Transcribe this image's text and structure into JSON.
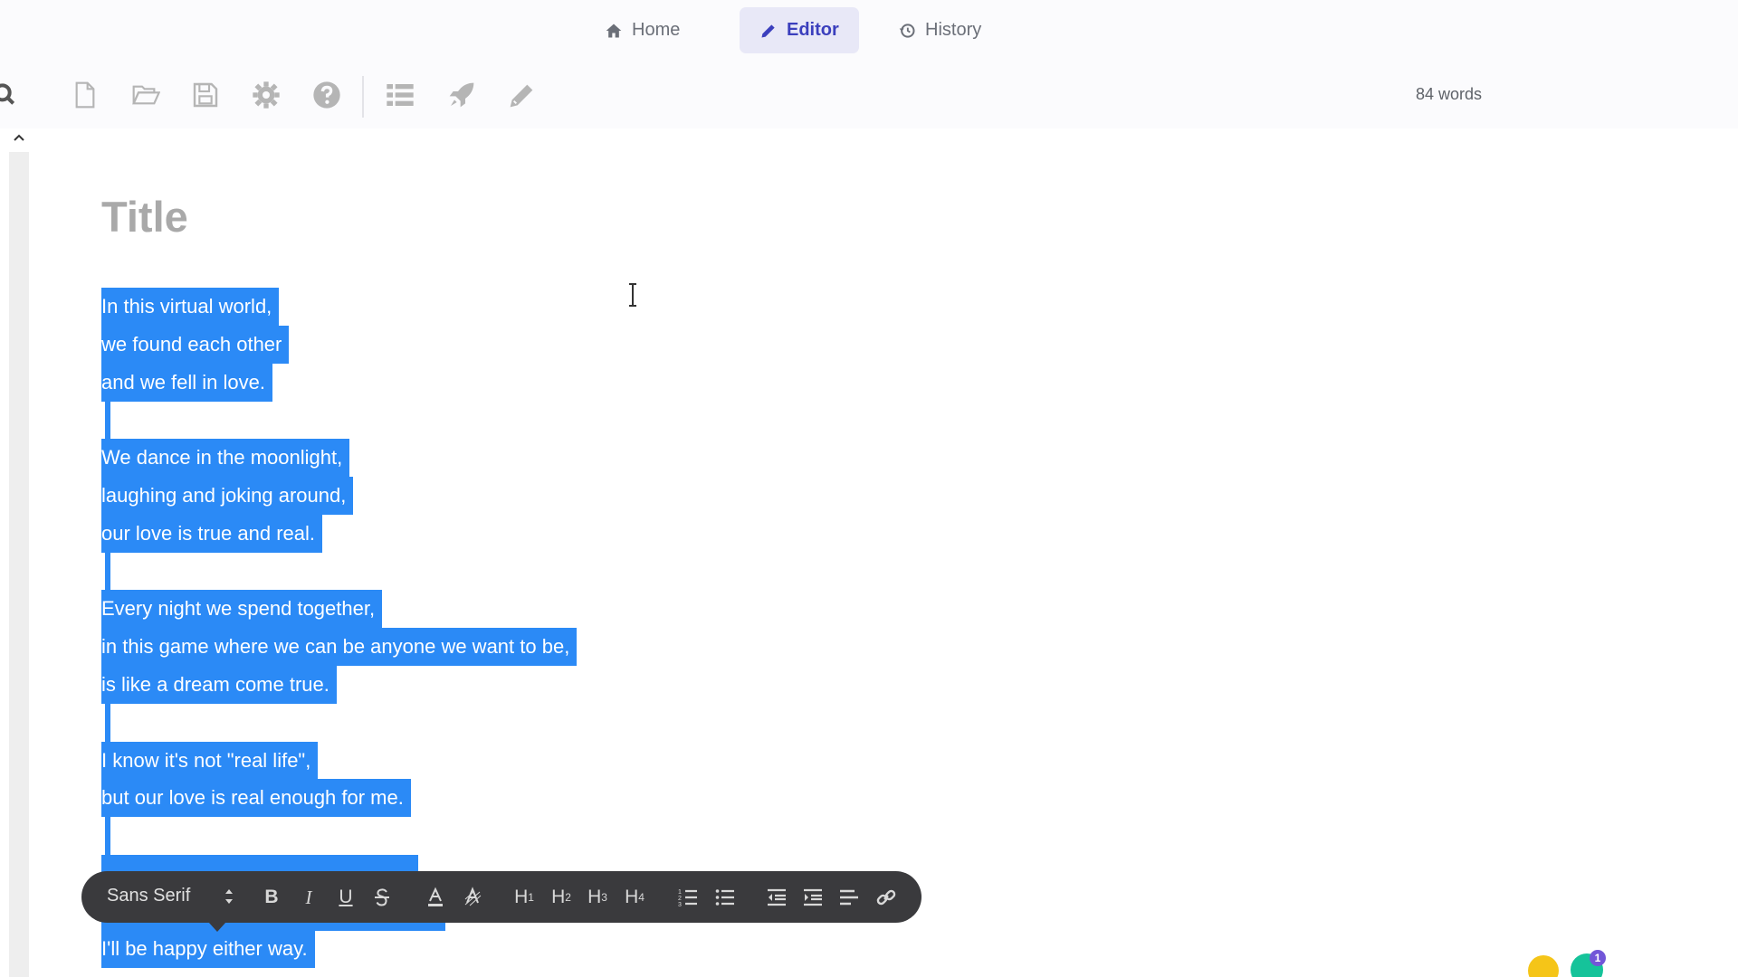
{
  "nav": {
    "home": "Home",
    "editor": "Editor",
    "history": "History"
  },
  "toolbar": {
    "word_count": "84 words"
  },
  "document": {
    "title_placeholder": "Title",
    "lines": [
      "In this virtual world,",
      "we found each other",
      "and we fell in love.",
      "We dance in the moonlight,",
      "laughing and joking around,",
      "our love is true and real.",
      "Every night we spend together,",
      "in this game where we can be anyone we want to be,",
      "is like a dream come true.",
      "I know it's not \"real life\",",
      "but our love is real enough for me.",
      "I'll be happy either way."
    ]
  },
  "format_bar": {
    "font": "Sans Serif",
    "h1": "H",
    "h2": "H",
    "h3": "H",
    "h4": "H",
    "h1_sub": "1",
    "h2_sub": "2",
    "h3_sub": "3",
    "h4_sub": "4"
  },
  "notifications": {
    "grammarly_count": "1"
  },
  "colors": {
    "selection": "#2b8af6",
    "accent": "#3b3fbd",
    "format_bar_bg": "#3a3a3d"
  }
}
